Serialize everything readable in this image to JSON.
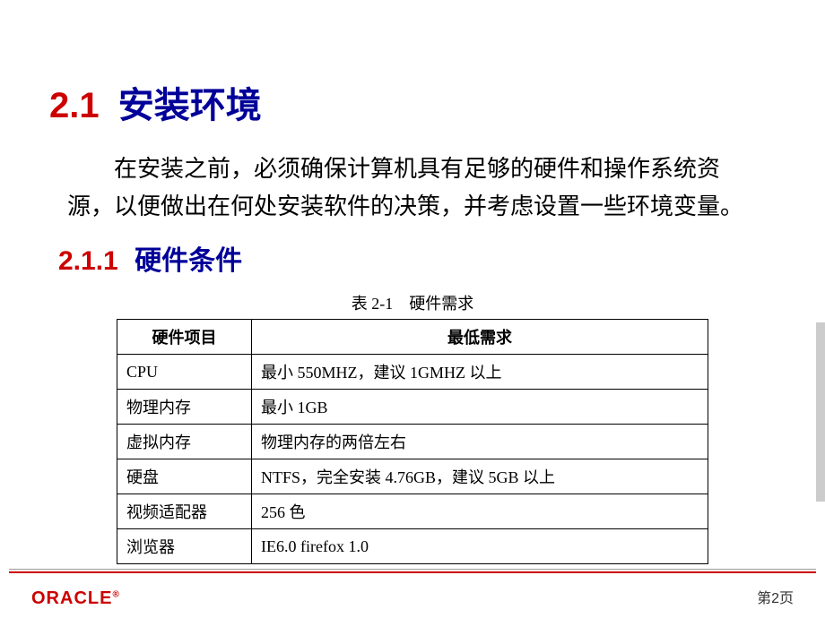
{
  "heading": {
    "number": "2.1",
    "title": "安装环境"
  },
  "paragraph": "在安装之前，必须确保计算机具有足够的硬件和操作系统资源，以便做出在何处安装软件的决策，并考虑设置一些环境变量。",
  "subheading": {
    "number": "2.1.1",
    "title": "硬件条件"
  },
  "table": {
    "caption": "表 2-1　硬件需求",
    "headers": [
      "硬件项目",
      "最低需求"
    ],
    "rows": [
      [
        "CPU",
        "最小 550MHZ，建议 1GMHZ 以上"
      ],
      [
        "物理内存",
        "最小 1GB"
      ],
      [
        "虚拟内存",
        "物理内存的两倍左右"
      ],
      [
        "硬盘",
        "NTFS，完全安装 4.76GB，建议 5GB 以上"
      ],
      [
        "视频适配器",
        "256 色"
      ],
      [
        "浏览器",
        "IE6.0 firefox 1.0"
      ]
    ]
  },
  "footer": {
    "logo": "ORACLE",
    "pageLabel": "第2页"
  }
}
